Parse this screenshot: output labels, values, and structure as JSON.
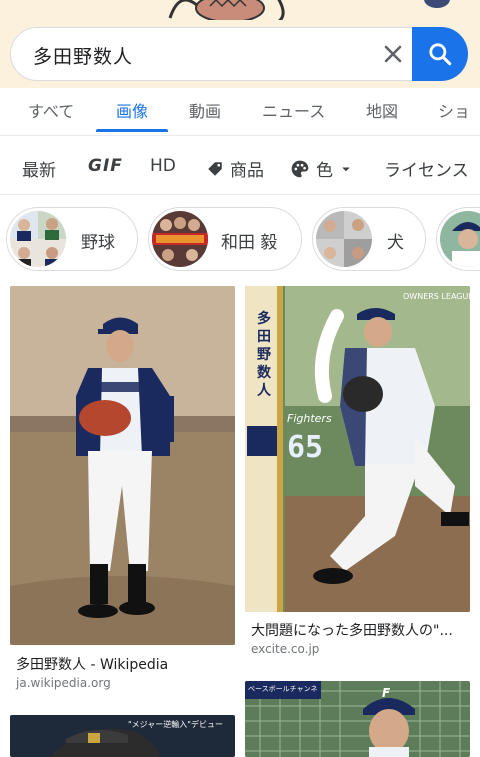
{
  "search": {
    "query": "多田野数人"
  },
  "tabs": [
    {
      "label": "すべて"
    },
    {
      "label": "画像"
    },
    {
      "label": "動画"
    },
    {
      "label": "ニュース"
    },
    {
      "label": "地図"
    },
    {
      "label": "ショ"
    }
  ],
  "active_tab": "画像",
  "filters": [
    {
      "label": "最新"
    },
    {
      "label": "GIF"
    },
    {
      "label": "HD"
    },
    {
      "label": "商品",
      "icon": "tag-icon"
    },
    {
      "label": "色",
      "icon": "palette-icon"
    },
    {
      "label": "ライセンス"
    }
  ],
  "chips": [
    {
      "label": "野球"
    },
    {
      "label": "和田 毅"
    },
    {
      "label": "犬"
    }
  ],
  "results": [
    {
      "title": "多田野数人 - Wikipedia",
      "source": "ja.wikipedia.org"
    },
    {
      "title": "大問題になった多田野数人の\"...",
      "source": "excite.co.jp"
    },
    {
      "title": "",
      "source": ""
    },
    {
      "title": "",
      "source": ""
    }
  ],
  "card_text": {
    "name_vertical": "多田野数人",
    "number": "65",
    "league": "OWNERS LEAGUE",
    "team_script": "Fighters",
    "jersey_script": "FIGHTERS",
    "broadcast_banner": "ベースボールチャンネル",
    "caption_snippet": "\"メジャー逆輸入\"デビュー",
    "cap_letter": "F"
  },
  "colors": {
    "accent": "#1a73e8",
    "doodle_bg": "#fbf1dc",
    "fighters_navy": "#1b2a5e"
  }
}
